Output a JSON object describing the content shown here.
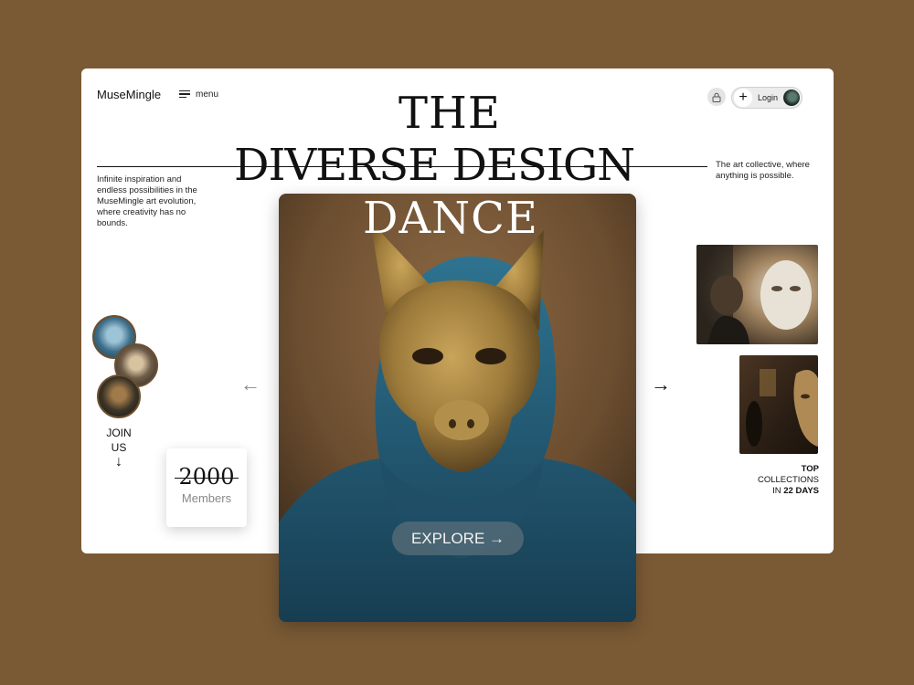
{
  "header": {
    "logo": "MuseMingle",
    "menu_label": "menu",
    "login_label": "Login"
  },
  "hero": {
    "title_line1": "THE",
    "title_line2": "DIVERSE DESIGN",
    "title_line3": "DANCE",
    "left_description": "Infinite inspiration and endless possibilities in the MuseMingle art evolution, where creativity has no bounds.",
    "right_description": "The art collective, where anything is possible.",
    "explore_label": "EXPLORE →"
  },
  "join": {
    "line1": "JOIN",
    "line2": "US",
    "arrow": "↓"
  },
  "members": {
    "count": "2000",
    "label": "Members"
  },
  "collections": {
    "line1": "TOP",
    "line2": "COLLECTIONS",
    "line3_prefix": "IN ",
    "line3_bold": "22 DAYS"
  },
  "nav": {
    "prev_arrow": "←",
    "next_arrow": "→"
  },
  "colors": {
    "background": "#7a5a35",
    "card": "#ffffff",
    "accent_blue": "#2f6a86"
  },
  "icons": [
    "menu-icon",
    "lock-icon",
    "plus-icon",
    "avatar",
    "arrow-left-icon",
    "arrow-right-icon",
    "arrow-down-icon"
  ]
}
